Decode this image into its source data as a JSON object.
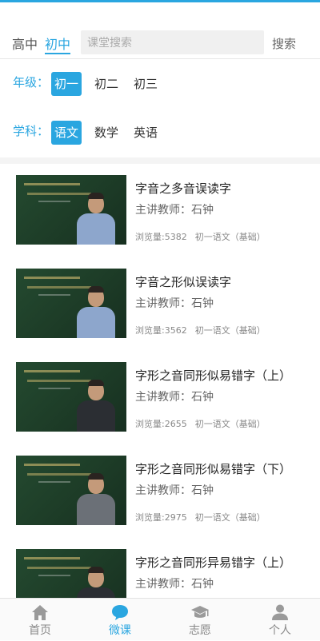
{
  "header": {
    "levels": [
      "高中",
      "初中"
    ],
    "active_level": "初中",
    "search_placeholder": "课堂搜索",
    "search_button": "搜索"
  },
  "filters": {
    "grade_label": "年级：",
    "grades": [
      "初一",
      "初二",
      "初三"
    ],
    "grade_selected": "初一",
    "subject_label": "学科：",
    "subjects": [
      "语文",
      "数学",
      "英语"
    ],
    "subject_selected": "语文"
  },
  "courses": [
    {
      "title": "字音之多音误读字",
      "teacher": "主讲教师：石钟",
      "views": "浏览量:5382",
      "category": "初一语文（基础）"
    },
    {
      "title": "字音之形似误读字",
      "teacher": "主讲教师：石钟",
      "views": "浏览量:3562",
      "category": "初一语文（基础）"
    },
    {
      "title": "字形之音同形似易错字（上）",
      "teacher": "主讲教师：石钟",
      "views": "浏览量:2655",
      "category": "初一语文（基础）"
    },
    {
      "title": "字形之音同形似易错字（下）",
      "teacher": "主讲教师：石钟",
      "views": "浏览量:2975",
      "category": "初一语文（基础）"
    },
    {
      "title": "字形之音同形异易错字（上）",
      "teacher": "主讲教师：石钟",
      "views": "",
      "category": ""
    }
  ],
  "nav": [
    {
      "label": "首页",
      "icon": "home-icon",
      "active": false
    },
    {
      "label": "微课",
      "icon": "chat-bubble-icon",
      "active": true
    },
    {
      "label": "志愿",
      "icon": "graduation-cap-icon",
      "active": false
    },
    {
      "label": "个人",
      "icon": "person-icon",
      "active": false
    }
  ],
  "colors": {
    "accent": "#2aa6e0",
    "inactive": "#888888"
  }
}
